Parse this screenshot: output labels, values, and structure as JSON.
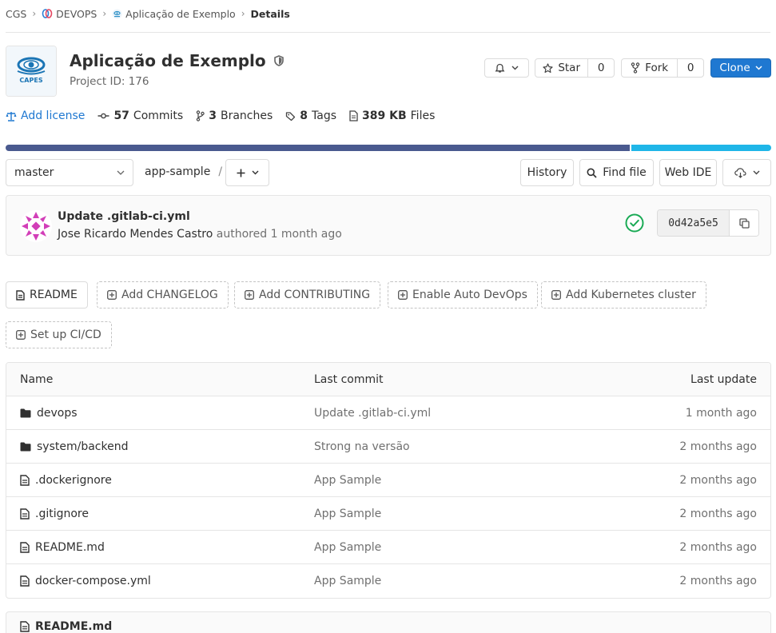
{
  "breadcrumb": {
    "items": [
      {
        "label": "CGS"
      },
      {
        "label": "DEVOPS"
      },
      {
        "label": "Aplicação de Exemplo"
      },
      {
        "label": "Details"
      }
    ]
  },
  "project": {
    "title": "Aplicação de Exemplo",
    "id_text": "Project ID: 176",
    "logo_text": "CAPES"
  },
  "actions": {
    "notification_icon": "bell-icon",
    "star_label": "Star",
    "star_count": "0",
    "fork_label": "Fork",
    "fork_count": "0",
    "clone_label": "Clone"
  },
  "stats": {
    "license": "Add license",
    "commits_count": "57",
    "commits_label": "Commits",
    "branches_count": "3",
    "branches_label": "Branches",
    "tags_count": "8",
    "tags_label": "Tags",
    "files_size": "389 KB",
    "files_label": "Files"
  },
  "languages": [
    {
      "color": "#4a5a8f",
      "share": 0.815
    },
    {
      "color": "#1fb6e8",
      "share": 0.185
    }
  ],
  "nav": {
    "branch": "master",
    "path_root": "app-sample",
    "path_sep": "/",
    "history": "History",
    "find_file": "Find file",
    "web_ide": "Web IDE"
  },
  "last_commit": {
    "title": "Update .gitlab-ci.yml",
    "author": "Jose Ricardo Mendes Castro",
    "authored": "authored",
    "time": "1 month ago",
    "sha": "0d42a5e5",
    "status": "passed"
  },
  "quick_links": [
    {
      "label": "README",
      "style": "solid"
    },
    {
      "label": "Add CHANGELOG",
      "style": "dashed"
    },
    {
      "label": "Add CONTRIBUTING",
      "style": "dashed"
    },
    {
      "label": "Enable Auto DevOps",
      "style": "dashed"
    },
    {
      "label": "Add Kubernetes cluster",
      "style": "dashed"
    },
    {
      "label": "Set up CI/CD",
      "style": "dashed"
    }
  ],
  "tree": {
    "headers": {
      "name": "Name",
      "last_commit": "Last commit",
      "last_update": "Last update"
    },
    "rows": [
      {
        "type": "folder",
        "name": "devops",
        "commit": "Update .gitlab-ci.yml",
        "updated": "1 month ago"
      },
      {
        "type": "folder",
        "name": "system/backend",
        "commit": "Strong na versão",
        "updated": "2 months ago"
      },
      {
        "type": "file",
        "name": ".dockerignore",
        "commit": "App Sample",
        "updated": "2 months ago"
      },
      {
        "type": "file",
        "name": ".gitignore",
        "commit": "App Sample",
        "updated": "2 months ago"
      },
      {
        "type": "file",
        "name": "README.md",
        "commit": "App Sample",
        "updated": "2 months ago"
      },
      {
        "type": "file",
        "name": "docker-compose.yml",
        "commit": "App Sample",
        "updated": "2 months ago"
      }
    ]
  },
  "readme": {
    "title": "README.md"
  }
}
